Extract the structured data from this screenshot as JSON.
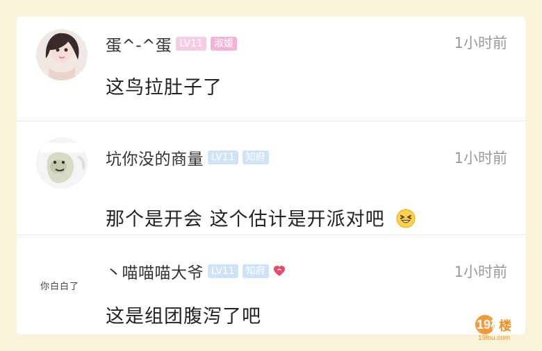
{
  "comments": [
    {
      "username": "蛋^-^蛋",
      "level_badge": "LV11",
      "title_badge": "淑媛",
      "time": "1小时前",
      "text": "这鸟拉肚子了"
    },
    {
      "username": "坑你没的商量",
      "level_badge": "LV11",
      "title_badge": "知府",
      "time": "1小时前",
      "text": "那个是开会 这个估计是开派对吧"
    },
    {
      "username": "丶喵喵喵大爷",
      "level_badge": "LV11",
      "title_badge": "知府",
      "time": "1小时前",
      "text": "这是组团腹泻了吧",
      "avatar_text": "你白白了"
    }
  ],
  "watermark": {
    "logo_text": "19楼",
    "domain_text": "19lou.com"
  },
  "icons": {
    "heart": "heart-icon",
    "emoji": "laughing-emoji-icon"
  },
  "colors": {
    "background": "#f8f3d9",
    "pink_badge": "#f3b2d6",
    "blue_badge": "#cfe3f6",
    "time": "#999999"
  }
}
